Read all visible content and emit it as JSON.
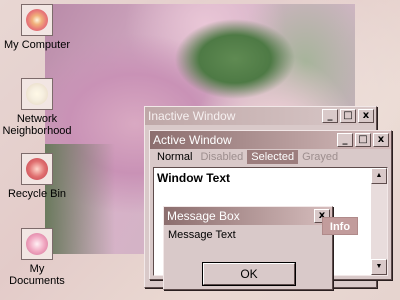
{
  "desktop": {
    "icons": [
      {
        "label_lines": [
          "My Computer"
        ],
        "icon": "computer-icon"
      },
      {
        "label_lines": [
          "Network",
          "Neighborhood"
        ],
        "icon": "network-icon"
      },
      {
        "label_lines": [
          "Recycle Bin"
        ],
        "icon": "recycle-bin-icon"
      },
      {
        "label_lines": [
          "My Documents"
        ],
        "icon": "documents-icon"
      }
    ]
  },
  "inactive_window": {
    "title": "Inactive Window"
  },
  "active_window": {
    "title": "Active Window",
    "menu": {
      "normal": "Normal",
      "disabled": "Disabled",
      "selected": "Selected",
      "grayed": "Grayed"
    },
    "text": "Window Text"
  },
  "message_box": {
    "title": "Message Box",
    "text": "Message Text",
    "ok_label": "OK",
    "close_glyph": "x"
  },
  "tooltip": {
    "text": "Info"
  },
  "title_buttons": {
    "minimize": "_",
    "maximize": "□",
    "close": "x"
  },
  "scroll": {
    "up": "▲",
    "down": "▼"
  },
  "colors": {
    "active_title_start": "#8c6e6e",
    "active_title_end": "#d6bdbd",
    "selected_menu": "#9c7d7d",
    "tooltip_bg": "#c29c9c"
  }
}
